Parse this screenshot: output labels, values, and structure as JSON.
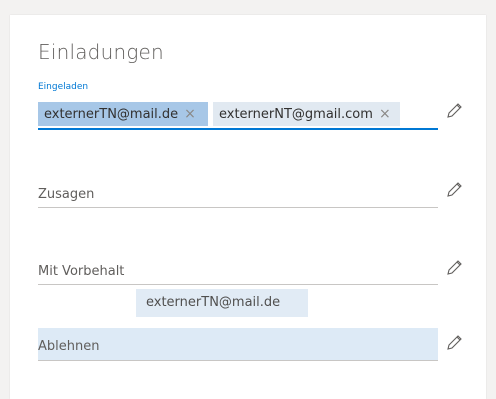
{
  "title": "Einladungen",
  "fields": {
    "invited": {
      "label": "Eingeladen",
      "chips": [
        {
          "text": "externerTN@mail.de",
          "remove": "×"
        },
        {
          "text": "externerNT@gmail.com",
          "remove": "×"
        }
      ]
    },
    "accepted": {
      "label": "Zusagen"
    },
    "tentative": {
      "label": "Mit Vorbehalt"
    },
    "declined": {
      "label": "Ablehnen"
    }
  },
  "drag": {
    "text": "externerTN@mail.de"
  },
  "icons": {
    "edit": "pencil-icon"
  },
  "colors": {
    "accent": "#0078d4",
    "dropHighlight": "#ddeaf6",
    "chipSelected": "#a7c7e7"
  }
}
